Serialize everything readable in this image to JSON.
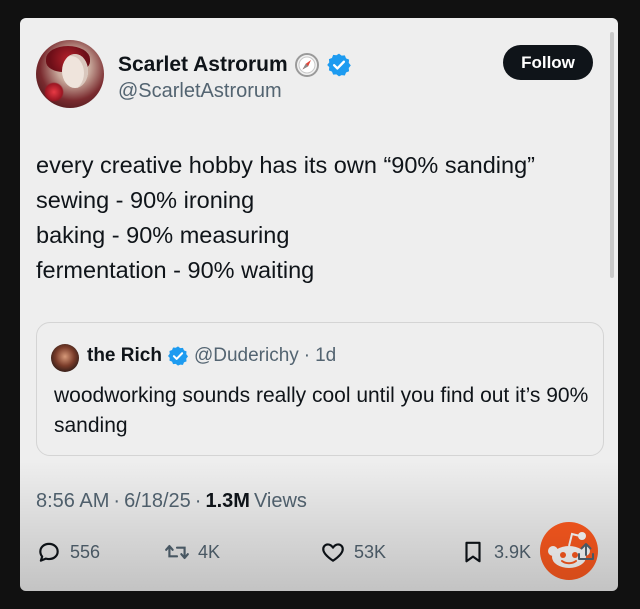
{
  "author": {
    "display_name": "Scarlet Astrorum",
    "handle": "@ScarletAstrorum"
  },
  "follow_label": "Follow",
  "tweet_lines": [
    "every creative hobby has its own “90% sanding”",
    "sewing - 90% ironing",
    "baking - 90% measuring",
    "fermentation - 90% waiting"
  ],
  "quote": {
    "display_name": "the Rich",
    "handle": "@Duderichy",
    "separator": "·",
    "age": "1d",
    "text": "woodworking sounds really cool until you find out it’s 90% sanding"
  },
  "timestamp": {
    "time": "8:56 AM",
    "sep1": "·",
    "date": "6/18/25",
    "sep2": "·",
    "views_count": "1.3M",
    "views_label": "Views"
  },
  "actions": {
    "replies": "556",
    "reposts": "4K",
    "likes": "53K",
    "bookmarks": "3.9K"
  },
  "colors": {
    "verified_blue": "#1d9bf0",
    "text_primary": "#0f1419",
    "text_secondary": "#536471",
    "reddit_orange": "#ff5a1f"
  },
  "icons": [
    "compass-icon",
    "verified-badge-icon",
    "reply-icon",
    "repost-icon",
    "like-icon",
    "bookmark-icon",
    "share-icon",
    "reddit-logo-icon"
  ]
}
